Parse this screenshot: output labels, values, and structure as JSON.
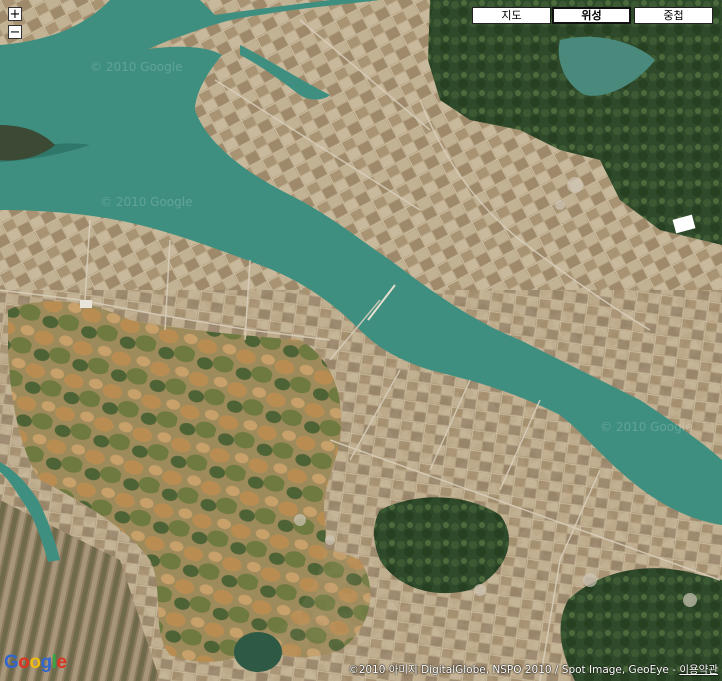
{
  "map": {
    "colors": {
      "water": "#3f8f80",
      "water_dark": "#2f7768",
      "paddy": "#b9a788",
      "paddy_dark": "#8e7d63",
      "field_brown": "#b08a55",
      "forest": "#2f4a2a",
      "forest_light": "#4c6a3c",
      "road": "#d9d0bd"
    }
  },
  "controls": {
    "zoom_in": "+",
    "zoom_out": "−"
  },
  "map_types": {
    "map": "지도",
    "satellite": "위성",
    "hybrid": "중첩",
    "active": "satellite"
  },
  "logo": {
    "letters": [
      "G",
      "o",
      "o",
      "g",
      "l",
      "e"
    ]
  },
  "attribution": {
    "text": "©2010 아미지 DigitalGlobe, NSPO 2010 / Spot Image, GeoEye - ",
    "terms": "이용약관"
  },
  "watermarks": {
    "text": "© 2010 Google"
  }
}
